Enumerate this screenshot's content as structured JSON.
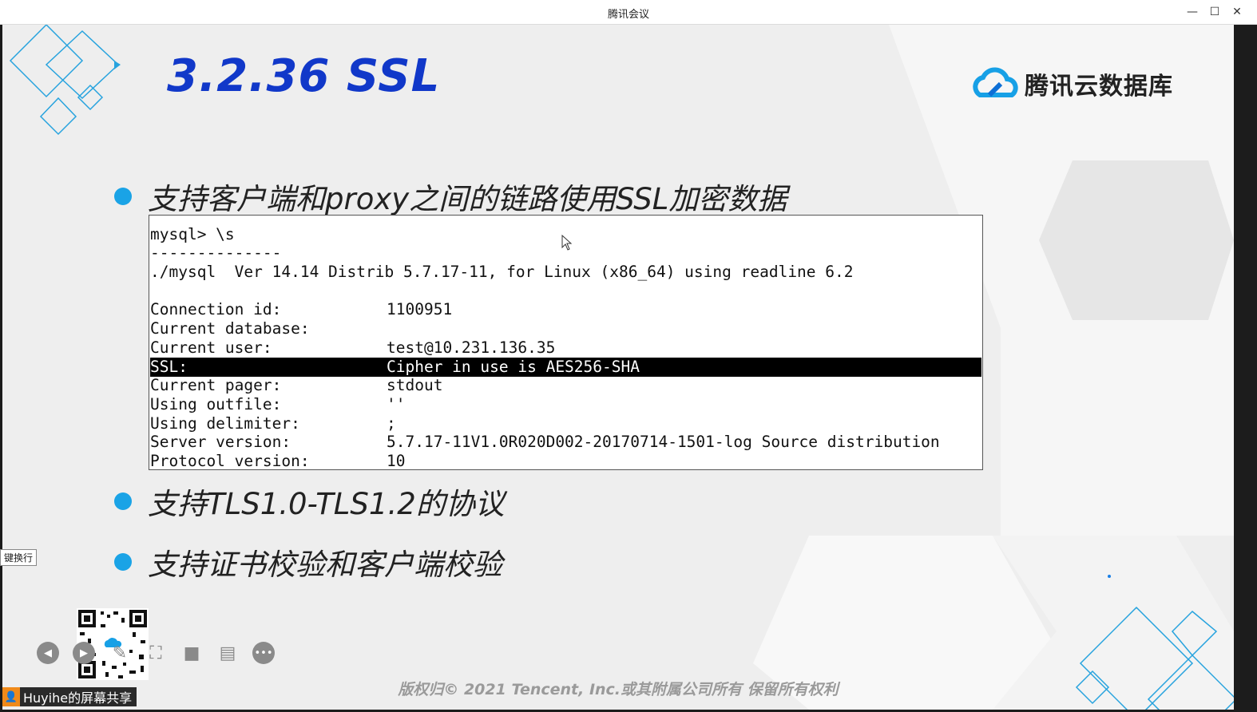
{
  "window": {
    "title": "腾讯会议",
    "minimize": "—",
    "maximize": "☐",
    "close": "✕"
  },
  "slide": {
    "title": "3.2.36 SSL",
    "logo_text": "腾讯云数据库",
    "bullets": [
      "支持客户端和proxy之间的链路使用SSL加密数据",
      "支持TLS1.0-TLS1.2的协议",
      "支持证书校验和客户端校验"
    ],
    "terminal": {
      "lines": [
        {
          "k": "mysql> \\s",
          "v": ""
        },
        {
          "k": "--------------",
          "v": ""
        },
        {
          "k": "./mysql  Ver 14.14 Distrib 5.7.17-11, for Linux (x86_64) using readline 6.2",
          "v": ""
        },
        {
          "k": "",
          "v": ""
        },
        {
          "k": "Connection id:",
          "v": "1100951"
        },
        {
          "k": "Current database:",
          "v": ""
        },
        {
          "k": "Current user:",
          "v": "test@10.231.136.35"
        },
        {
          "k": "SSL:",
          "v": "Cipher in use is AES256-SHA"
        },
        {
          "k": "Current pager:",
          "v": "stdout"
        },
        {
          "k": "Using outfile:",
          "v": "''"
        },
        {
          "k": "Using delimiter:",
          "v": ";"
        },
        {
          "k": "Server version:",
          "v": "5.7.17-11V1.0R020D002-20170714-1501-log Source distribution"
        },
        {
          "k": "Protocol version:",
          "v": "10"
        }
      ]
    },
    "footer": "版权归© 2021 Tencent, Inc.或其附属公司所有 保留所有权利"
  },
  "meeting": {
    "share_label": "Huyihe的屏幕共享",
    "tooltip": "键换行",
    "controls": [
      "prev-icon",
      "next-icon",
      "pen-icon",
      "screenshot-icon",
      "camera-icon",
      "chat-icon",
      "more-icon"
    ]
  },
  "colors": {
    "title_blue": "#1138c9",
    "bullet_blue": "#1aa3e6",
    "share_orange": "#f08a1a"
  }
}
